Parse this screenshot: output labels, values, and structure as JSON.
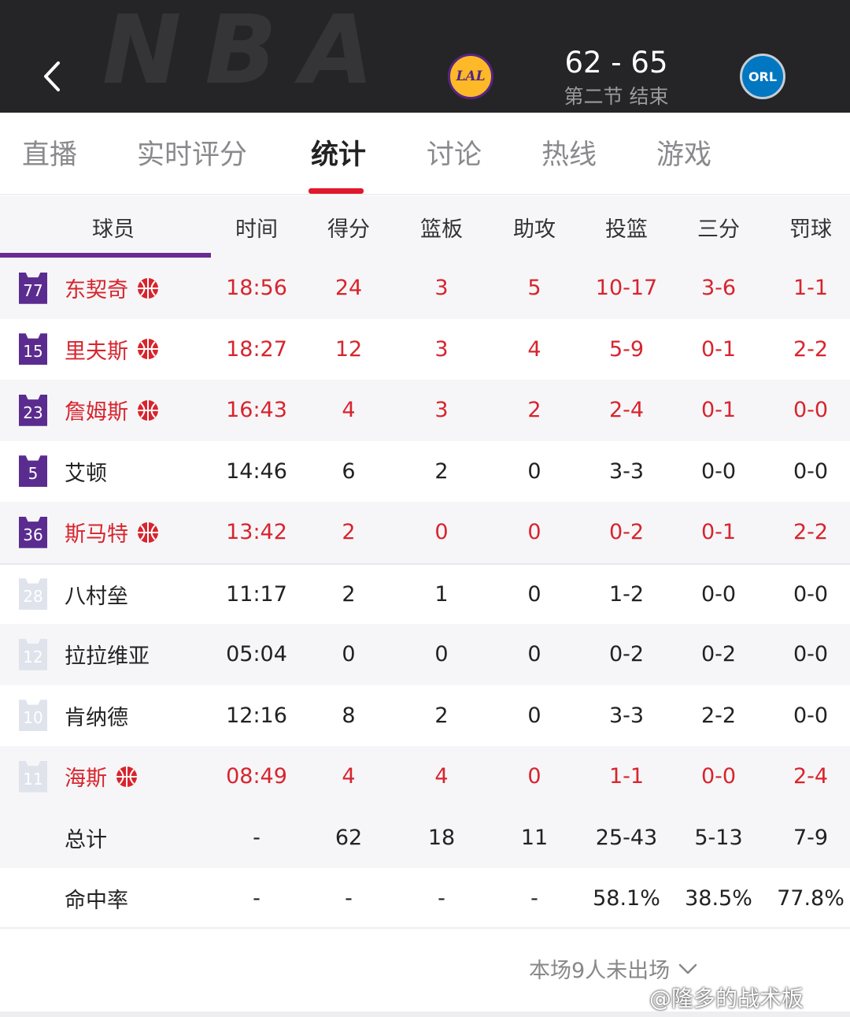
{
  "header": {
    "score": "62 - 65",
    "period": "第二节 结束",
    "home_logo_text": "LAL",
    "away_logo_text": "ORL",
    "bg_text": "NBA"
  },
  "tabs": [
    {
      "label": "直播",
      "active": false
    },
    {
      "label": "实时评分",
      "active": false
    },
    {
      "label": "统计",
      "active": true
    },
    {
      "label": "讨论",
      "active": false
    },
    {
      "label": "热线",
      "active": false
    },
    {
      "label": "游戏",
      "active": false
    }
  ],
  "table": {
    "headers": {
      "player": "球员",
      "time": "时间",
      "pts": "得分",
      "reb": "篮板",
      "ast": "助攻",
      "fg": "投篮",
      "three": "三分",
      "ft": "罚球"
    },
    "players": [
      {
        "number": "77",
        "name": "东契奇",
        "starter": true,
        "highlight": true,
        "icon": "basketball-icon",
        "time": "18:56",
        "pts": "24",
        "reb": "3",
        "ast": "5",
        "fg": "10-17",
        "three": "3-6",
        "ft": "1-1"
      },
      {
        "number": "15",
        "name": "里夫斯",
        "starter": true,
        "highlight": true,
        "icon": "basketball-icon",
        "time": "18:27",
        "pts": "12",
        "reb": "3",
        "ast": "4",
        "fg": "5-9",
        "three": "0-1",
        "ft": "2-2"
      },
      {
        "number": "23",
        "name": "詹姆斯",
        "starter": true,
        "highlight": true,
        "icon": "basketball-icon",
        "time": "16:43",
        "pts": "4",
        "reb": "3",
        "ast": "2",
        "fg": "2-4",
        "three": "0-1",
        "ft": "0-0"
      },
      {
        "number": "5",
        "name": "艾顿",
        "starter": true,
        "highlight": false,
        "icon": "",
        "time": "14:46",
        "pts": "6",
        "reb": "2",
        "ast": "0",
        "fg": "3-3",
        "three": "0-0",
        "ft": "0-0"
      },
      {
        "number": "36",
        "name": "斯马特",
        "starter": true,
        "highlight": true,
        "icon": "basketball-icon",
        "time": "13:42",
        "pts": "2",
        "reb": "0",
        "ast": "0",
        "fg": "0-2",
        "three": "0-1",
        "ft": "2-2"
      },
      {
        "number": "28",
        "name": "八村垒",
        "starter": false,
        "highlight": false,
        "icon": "",
        "time": "11:17",
        "pts": "2",
        "reb": "1",
        "ast": "0",
        "fg": "1-2",
        "three": "0-0",
        "ft": "0-0"
      },
      {
        "number": "12",
        "name": "拉拉维亚",
        "starter": false,
        "highlight": false,
        "icon": "",
        "time": "05:04",
        "pts": "0",
        "reb": "0",
        "ast": "0",
        "fg": "0-2",
        "three": "0-2",
        "ft": "0-0"
      },
      {
        "number": "10",
        "name": "肯纳德",
        "starter": false,
        "highlight": false,
        "icon": "",
        "time": "12:16",
        "pts": "8",
        "reb": "2",
        "ast": "0",
        "fg": "3-3",
        "three": "2-2",
        "ft": "0-0"
      },
      {
        "number": "11",
        "name": "海斯",
        "starter": false,
        "highlight": true,
        "icon": "basketball-icon",
        "time": "08:49",
        "pts": "4",
        "reb": "4",
        "ast": "0",
        "fg": "1-1",
        "three": "0-0",
        "ft": "2-4"
      }
    ],
    "totals": {
      "label": "总计",
      "time": "-",
      "pts": "62",
      "reb": "18",
      "ast": "11",
      "fg": "25-43",
      "three": "5-13",
      "ft": "7-9"
    },
    "pct": {
      "label": "命中率",
      "time": "-",
      "pts": "-",
      "reb": "-",
      "ast": "-",
      "fg": "58.1%",
      "three": "38.5%",
      "ft": "77.8%"
    }
  },
  "footer": {
    "dnp_text": "本场9人未出场",
    "watermark": "@隆多的战术板"
  },
  "colors": {
    "header_bg": "#252527",
    "accent_red": "#d8242d",
    "tab_indicator": "#e0182d",
    "lakers_purple": "#5b2c8f",
    "bench_jersey": "#dfe3ec"
  }
}
